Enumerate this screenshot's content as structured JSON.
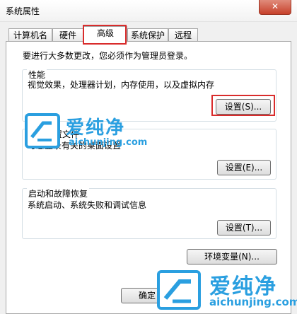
{
  "window": {
    "title": "系统属性",
    "close_glyph": "✕"
  },
  "tabs": [
    "计算机名",
    "硬件",
    "高级",
    "系统保护",
    "远程"
  ],
  "admin_note": "要进行大多数更改，您必须作为管理员登录。",
  "groups": [
    {
      "title": "性能",
      "description": "视觉效果，处理器计划，内存使用，以及虚拟内存",
      "button": "设置(S)..."
    },
    {
      "title": "用户配置文件",
      "description": "与您登录有关的桌面设置",
      "button": "设置(E)..."
    },
    {
      "title": "启动和故障恢复",
      "description": "系统启动、系统失败和调试信息",
      "button": "设置(T)..."
    }
  ],
  "env_button": "环境变量(N)...",
  "ok_button": "确定",
  "watermark": {
    "text": "爱纯净",
    "url": "aichunjing.com"
  },
  "colors": {
    "highlight": "#d92c2c",
    "watermark": "#2a9fe0"
  }
}
